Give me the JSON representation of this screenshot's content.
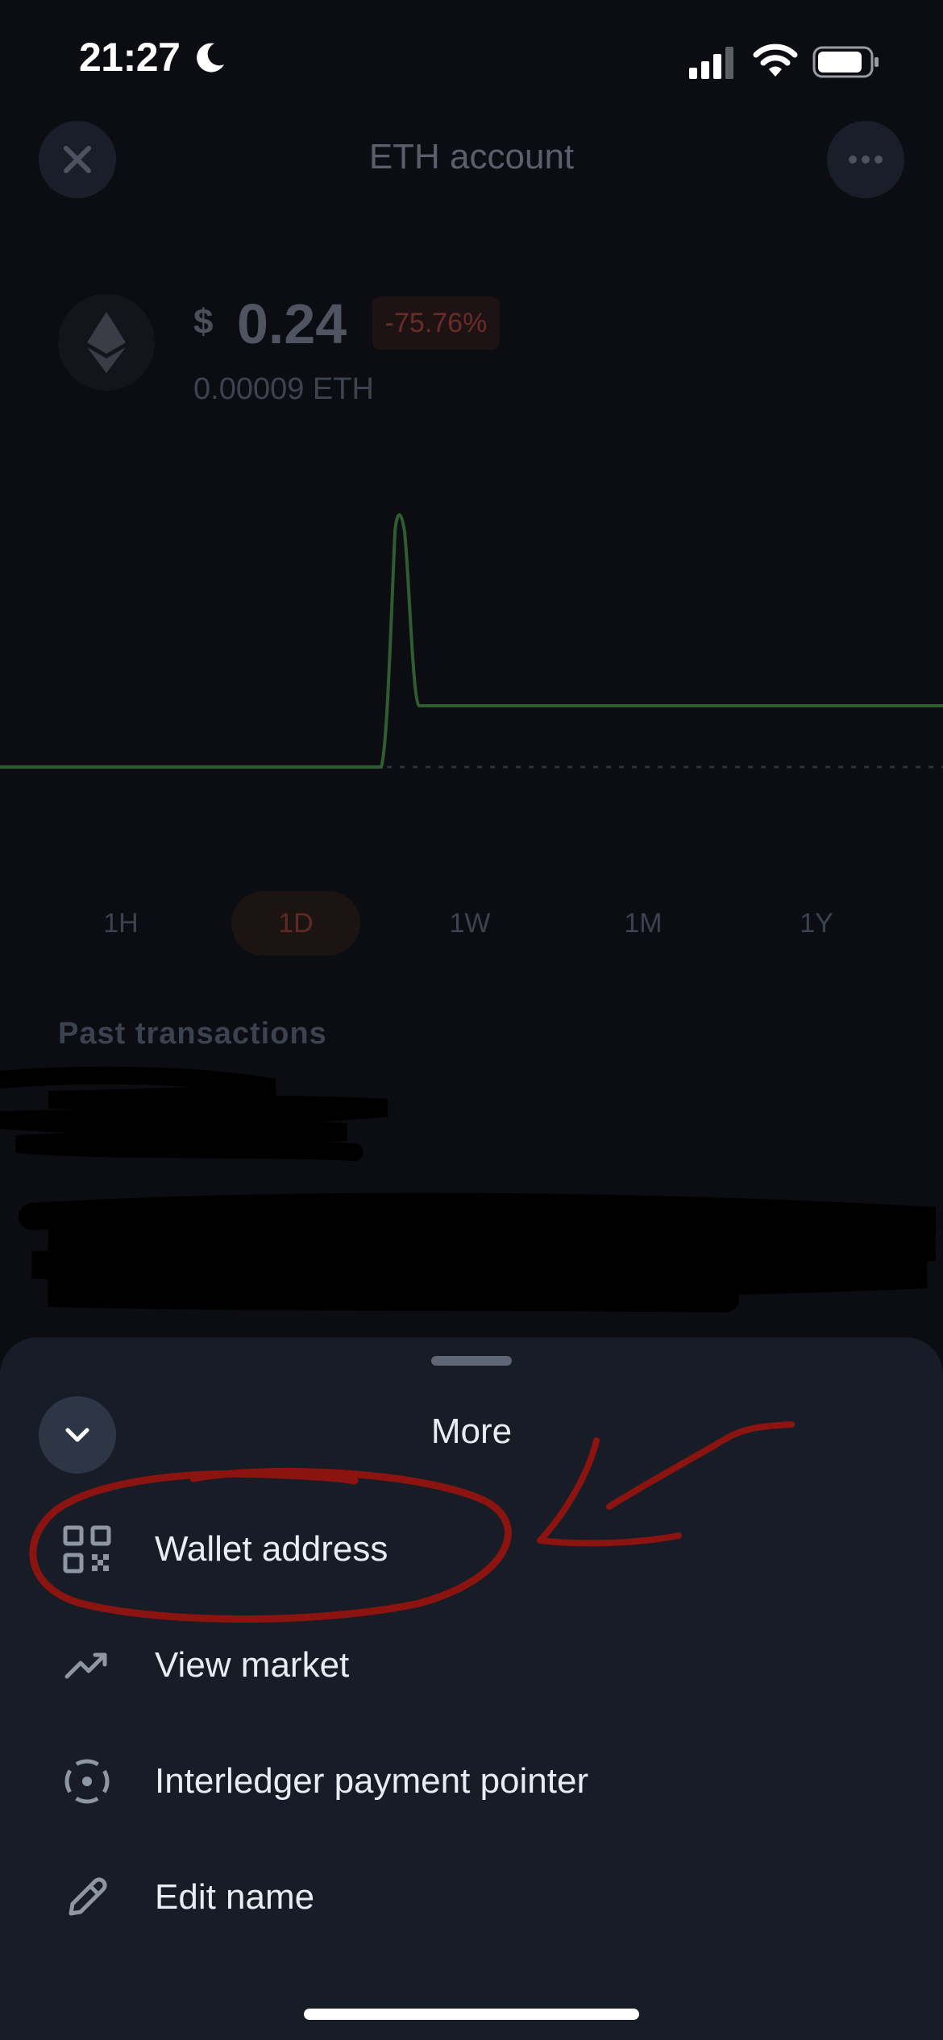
{
  "status_bar": {
    "time": "21:27"
  },
  "header": {
    "title": "ETH account"
  },
  "balance": {
    "currency_symbol": "$",
    "amount": "0.24",
    "change": "-75.76%",
    "eth_amount": "0.00009 ETH"
  },
  "timeframes": [
    "1H",
    "1D",
    "1W",
    "1M",
    "1Y"
  ],
  "selected_timeframe": "1D",
  "past_transactions_title": "Past transactions",
  "sheet": {
    "title": "More",
    "items": [
      {
        "label": "Wallet address",
        "icon": "qr-code-icon"
      },
      {
        "label": "View market",
        "icon": "trending-up-icon"
      },
      {
        "label": "Interledger payment pointer",
        "icon": "target-icon"
      },
      {
        "label": "Edit name",
        "icon": "pencil-icon"
      }
    ]
  },
  "colors": {
    "chart_line": "#2f5d31",
    "sheet_bg": "#171c26",
    "annotation": "#8b1410"
  }
}
